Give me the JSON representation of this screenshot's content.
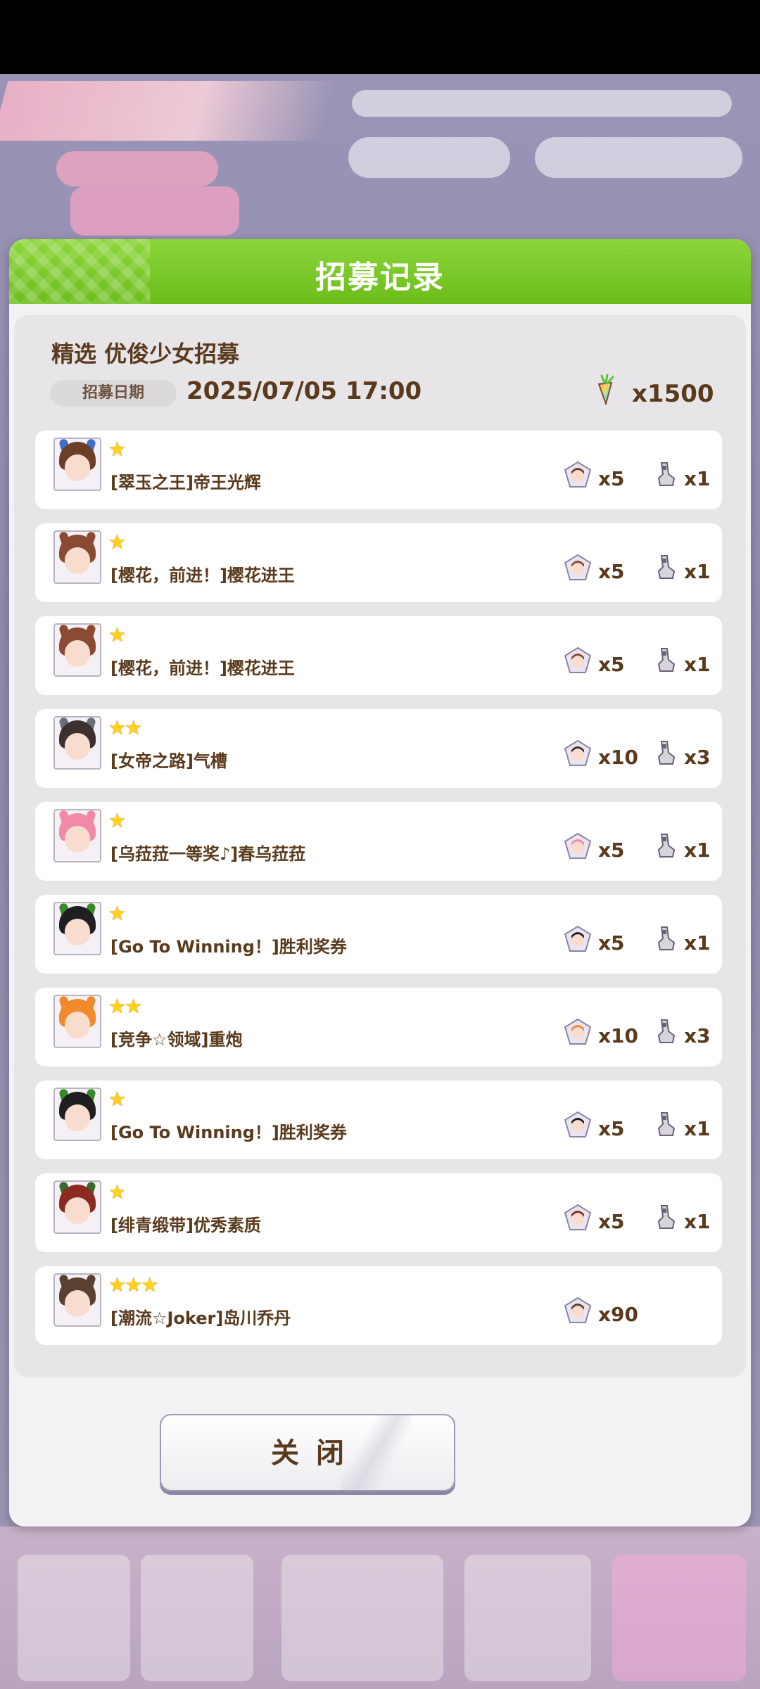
{
  "dialog": {
    "title": "招募记录",
    "banner_name": "精选 优俊少女招募",
    "date_label": "招募日期",
    "date_value": "2025/07/05 17:00",
    "cost": "x1500",
    "close_label": "关闭"
  },
  "records": [
    {
      "name": "[翠玉之王]帝王光辉",
      "stars": 1,
      "pieces": "x5",
      "items": "x1",
      "hair": "#6b3f2a",
      "ear": "#3f6ec8"
    },
    {
      "name": "[樱花，前进！]樱花进王",
      "stars": 1,
      "pieces": "x5",
      "items": "x1",
      "hair": "#8a4a33",
      "ear": "#8a4a33"
    },
    {
      "name": "[樱花，前进！]樱花进王",
      "stars": 1,
      "pieces": "x5",
      "items": "x1",
      "hair": "#8a4a33",
      "ear": "#8a4a33"
    },
    {
      "name": "[女帝之路]气槽",
      "stars": 2,
      "pieces": "x10",
      "items": "x3",
      "hair": "#3d3030",
      "ear": "#6c6c74"
    },
    {
      "name": "[乌菈菈一等奖♪]春乌菈菈",
      "stars": 1,
      "pieces": "x5",
      "items": "x1",
      "hair": "#f08aa8",
      "ear": "#f08aa8"
    },
    {
      "name": "[Go To Winning！]胜利奖券",
      "stars": 1,
      "pieces": "x5",
      "items": "x1",
      "hair": "#1f1f22",
      "ear": "#3a8a2a"
    },
    {
      "name": "[竞争☆领域]重炮",
      "stars": 2,
      "pieces": "x10",
      "items": "x3",
      "hair": "#f08a2a",
      "ear": "#f08a2a"
    },
    {
      "name": "[Go To Winning！]胜利奖券",
      "stars": 1,
      "pieces": "x5",
      "items": "x1",
      "hair": "#1f1f22",
      "ear": "#3a8a2a"
    },
    {
      "name": "[绯青缎带]优秀素质",
      "stars": 1,
      "pieces": "x5",
      "items": "x1",
      "hair": "#8a2a20",
      "ear": "#3a6a2a"
    },
    {
      "name": "[潮流☆Joker]岛川乔丹",
      "stars": 3,
      "pieces": "x90",
      "items": "",
      "hair": "#5a4030",
      "ear": "#5a4030"
    }
  ]
}
